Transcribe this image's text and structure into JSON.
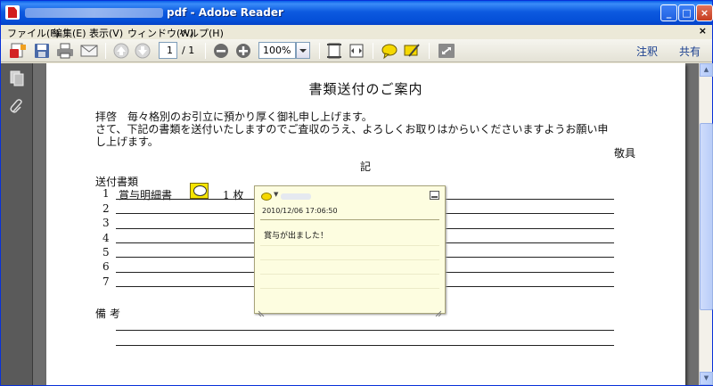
{
  "window": {
    "title": "pdf - Adobe Reader",
    "buttons": {
      "minimize": "_",
      "maximize": "□",
      "close": "×"
    }
  },
  "menu": {
    "items": [
      "ファイル(F)",
      "編集(E)",
      "表示(V)",
      "ウィンドウ(W)",
      "ヘルプ(H)"
    ],
    "close_glyph": "×"
  },
  "toolbar": {
    "page_current": "1",
    "page_total": "/ 1",
    "zoom": "100%",
    "annotate_label": "注釈",
    "share_label": "共有"
  },
  "document": {
    "title": "書類送付のご案内",
    "paragraph_lines": [
      "拝啓　毎々格別のお引立に預かり厚く御礼申し上げます。",
      "さて、下記の書類を送付いたしますのでご査収のうえ、よろしくお取りはからいくださいますようお願い申",
      "し上げます。"
    ],
    "closing": "敬具",
    "ki": "記",
    "list_title": "送付書類",
    "rows": [
      "1",
      "2",
      "3",
      "4",
      "5",
      "6",
      "7"
    ],
    "row1_item": "賞与明細書",
    "row1_qty": "1 枚",
    "remarks_label": "備考"
  },
  "note": {
    "date": "2010/12/06 17:06:50",
    "text": "賞与が出ました！",
    "author_caret": "▼"
  },
  "colors": {
    "titlebar": "#0550d8",
    "note_bg": "#fdfde0",
    "note_marker": "#f5e400",
    "viewer_bg": "#6e6e6e"
  },
  "icons": [
    "create-pdf-icon",
    "save-icon",
    "print-icon",
    "email-icon",
    "prev-page-icon",
    "next-page-icon",
    "zoom-out-icon",
    "zoom-in-icon",
    "fit-page-icon",
    "fit-width-icon",
    "comment-icon",
    "highlight-icon",
    "expand-icon",
    "pages-icon",
    "attachments-icon"
  ]
}
